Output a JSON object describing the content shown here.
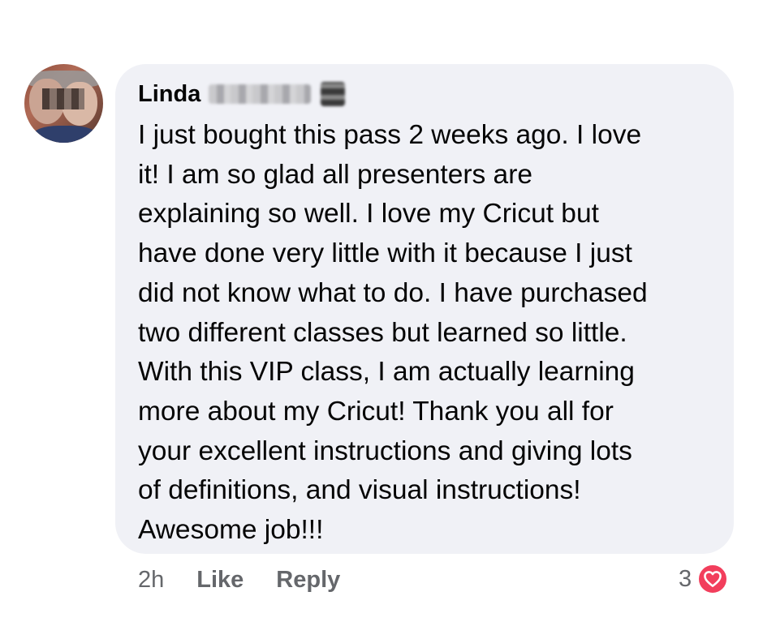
{
  "comment": {
    "author": "Linda",
    "text": "I just bought this pass 2 weeks ago.  I love\nit!  I am so glad all presenters are\nexplaining so well.  I love my Cricut but\nhave done very little with it because I just\ndid not know what to do.  I have purchased\ntwo different classes but learned so little.\nWith this VIP class, I am actually learning\nmore about my Cricut!  Thank you all for\nyour excellent instructions and giving lots\nof definitions, and visual instructions!\nAwesome job!!!",
    "time": "2h",
    "like_label": "Like",
    "reply_label": "Reply",
    "reaction_count": "3",
    "reaction_icon": "heart-icon"
  },
  "colors": {
    "bubble": "#f0f1f6",
    "meta_text": "#65676b",
    "heart": "#f23e5c"
  }
}
